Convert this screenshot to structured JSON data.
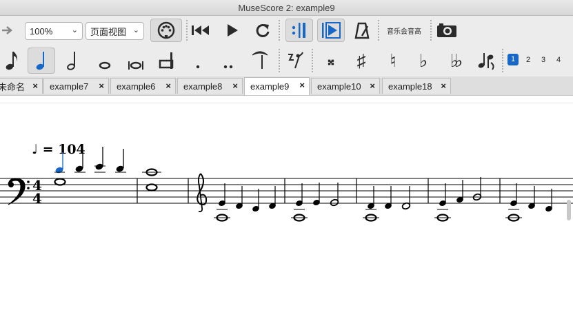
{
  "window": {
    "title": "MuseScore 2: example9"
  },
  "toolbar": {
    "zoom": "100%",
    "view_mode": "页面视图",
    "concert_pitch_label": "音乐会音高"
  },
  "palette": {
    "voices": [
      "1",
      "2",
      "3",
      "4"
    ],
    "accent_color": "#1667c7"
  },
  "tabs": [
    {
      "label": "未命名",
      "close": "×"
    },
    {
      "label": "example7",
      "close": "×"
    },
    {
      "label": "example6",
      "close": "×"
    },
    {
      "label": "example8",
      "close": "×"
    },
    {
      "label": "example9",
      "close": "×"
    },
    {
      "label": "example10",
      "close": "×"
    },
    {
      "label": "example18",
      "close": "×"
    }
  ],
  "score": {
    "tempo": "♩ = 104",
    "time_sig_top": "4",
    "time_sig_bottom": "4",
    "selected_note_color": "#1667c7"
  }
}
